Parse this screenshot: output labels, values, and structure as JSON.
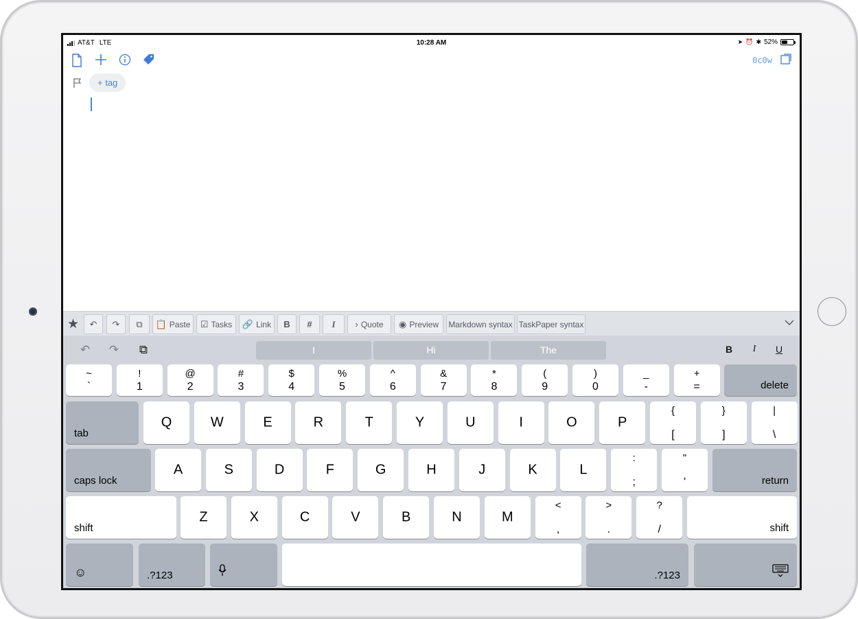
{
  "status": {
    "carrier": "AT&T",
    "network": "LTE",
    "time": "10:28 AM",
    "battery": "52%",
    "battery_level": 0.52
  },
  "toolbar": {
    "word_count": "0c0w"
  },
  "tag": {
    "label": "+ tag"
  },
  "format_bar": {
    "paste": "Paste",
    "tasks": "Tasks",
    "link": "Link",
    "quote": "Quote",
    "preview": "Preview",
    "markdown": "Markdown syntax",
    "taskpaper": "TaskPaper syntax"
  },
  "keyboard": {
    "suggestions": [
      "I",
      "Hi",
      "The"
    ],
    "format_keys": {
      "bold": "B",
      "italic": "I",
      "underline": "U"
    },
    "numbers_row": [
      {
        "top": "~",
        "bottom": "`"
      },
      {
        "top": "!",
        "bottom": "1"
      },
      {
        "top": "@",
        "bottom": "2"
      },
      {
        "top": "#",
        "bottom": "3"
      },
      {
        "top": "$",
        "bottom": "4"
      },
      {
        "top": "%",
        "bottom": "5"
      },
      {
        "top": "^",
        "bottom": "6"
      },
      {
        "top": "&",
        "bottom": "7"
      },
      {
        "top": "*",
        "bottom": "8"
      },
      {
        "top": "(",
        "bottom": "9"
      },
      {
        "top": ")",
        "bottom": "0"
      },
      {
        "top": "_",
        "bottom": "-"
      },
      {
        "top": "+",
        "bottom": "="
      }
    ],
    "delete": "delete",
    "tab": "tab",
    "qrow": [
      "Q",
      "W",
      "E",
      "R",
      "T",
      "Y",
      "U",
      "I",
      "O",
      "P"
    ],
    "qrow_symbols": [
      {
        "top": "{",
        "bottom": "["
      },
      {
        "top": "}",
        "bottom": "]"
      },
      {
        "top": "|",
        "bottom": "\\"
      }
    ],
    "caps_lock": "caps lock",
    "arow": [
      "A",
      "S",
      "D",
      "F",
      "G",
      "H",
      "J",
      "K",
      "L"
    ],
    "arow_symbols": [
      {
        "top": ":",
        "bottom": ";"
      },
      {
        "top": "\"",
        "bottom": "'"
      }
    ],
    "return": "return",
    "shift": "shift",
    "zrow": [
      "Z",
      "X",
      "C",
      "V",
      "B",
      "N",
      "M"
    ],
    "zrow_symbols": [
      {
        "top": "<",
        "bottom": ","
      },
      {
        "top": ">",
        "bottom": "."
      },
      {
        "top": "?",
        "bottom": "/"
      }
    ],
    "numbers_key": ".?123"
  }
}
